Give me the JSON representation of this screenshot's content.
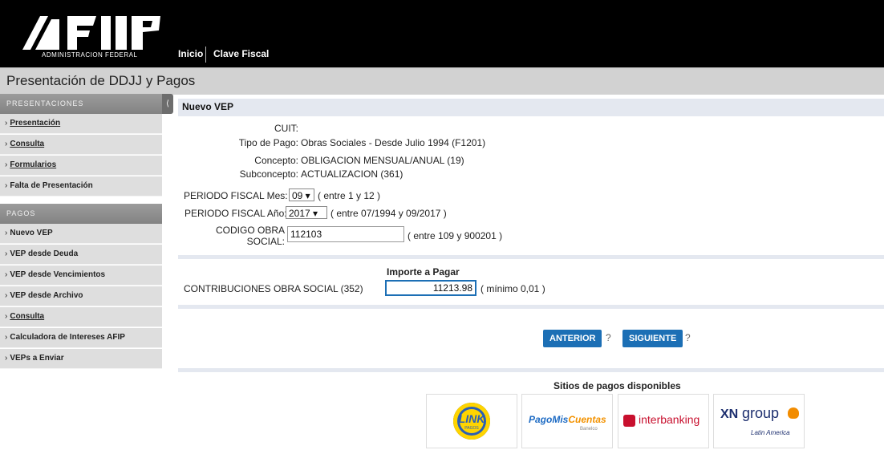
{
  "header": {
    "logo_subtitle": "ADMINISTRACION FEDERAL",
    "nav": [
      "Inicio",
      "Clave Fiscal"
    ]
  },
  "title": "Presentación de DDJJ y Pagos",
  "sidebar": {
    "presentaciones": {
      "heading": "PRESENTACIONES",
      "items": [
        "Presentación",
        "Consulta",
        "Formularios",
        "Falta de Presentación"
      ]
    },
    "pagos": {
      "heading": "PAGOS",
      "items": [
        "Nuevo VEP",
        "VEP desde Deuda",
        "VEP desde Vencimientos",
        "VEP desde Archivo",
        "Consulta",
        "Calculadora de Intereses AFIP",
        "VEPs a Enviar"
      ]
    },
    "collapse_glyph": "⟨"
  },
  "form": {
    "title": "Nuevo VEP",
    "cuit_label": "CUIT:",
    "tipo_pago_label": "Tipo de Pago:",
    "tipo_pago_value": "Obras Sociales - Desde Julio 1994 (F1201)",
    "concepto_label": "Concepto:",
    "concepto_value": "OBLIGACION MENSUAL/ANUAL (19)",
    "subconcepto_label": "Subconcepto:",
    "subconcepto_value": "ACTUALIZACION (361)",
    "mes_label": "PERIODO FISCAL Mes:",
    "mes_value": "09 ▾",
    "mes_hint": "( entre 1 y 12 )",
    "anio_label": "PERIODO FISCAL Año:",
    "anio_value": "2017 ▾",
    "anio_hint": "( entre 07/1994 y 09/2017 )",
    "codigo_label_1": "CODIGO OBRA",
    "codigo_label_2": "SOCIAL:",
    "codigo_value": "112103",
    "codigo_hint": "( entre 109 y 900201 )",
    "importe_header": "Importe a Pagar",
    "contrib_label": "CONTRIBUCIONES OBRA SOCIAL (352)",
    "importe_value": "11213.98",
    "importe_hint": "( mínimo 0,01 )",
    "btn_anterior": "ANTERIOR",
    "btn_siguiente": "SIGUIENTE",
    "help": "?",
    "sitios_title": "Sitios de pagos disponibles"
  },
  "payment_sites": {
    "link": "LINK",
    "link_sub": "PAGOS",
    "pmc_1": "PagoMis",
    "pmc_2": "Cuentas",
    "pmc_sub": "Banelco",
    "interbanking": "interbanking",
    "xn_1": "XN",
    "xn_2": "group",
    "xn_sub": "Latin America"
  },
  "colors": {
    "header_bg": "#000000",
    "button_blue": "#1c6fb5",
    "section_bar": "#e4e8f0"
  }
}
